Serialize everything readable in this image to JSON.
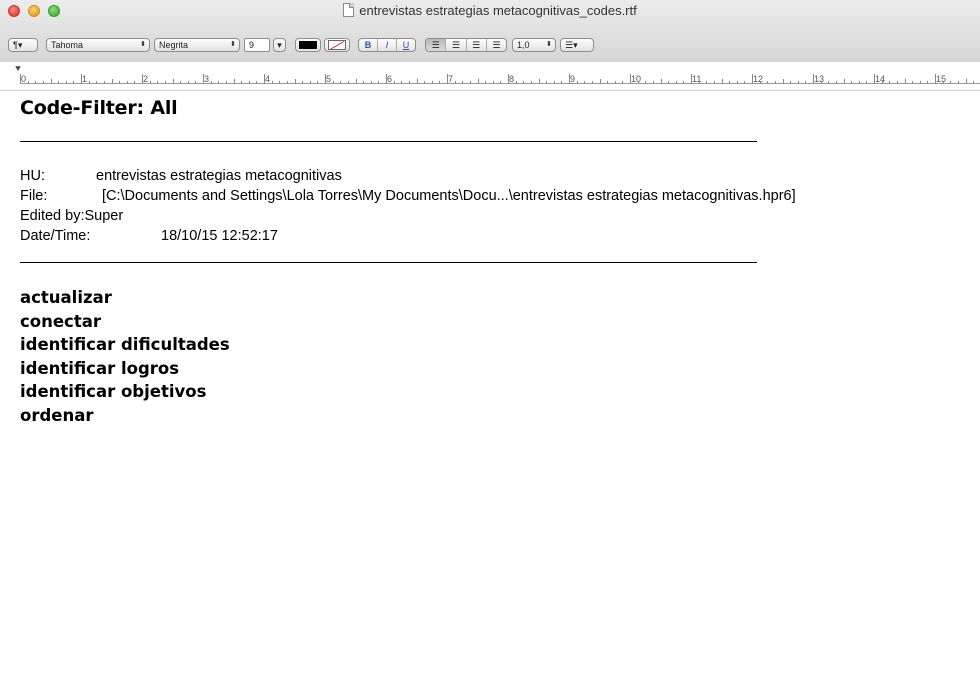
{
  "window": {
    "title": "entrevistas estrategias metacognitivas_codes.rtf"
  },
  "toolbar": {
    "paragraph_style": "¶▾",
    "font_family": "Tahoma",
    "font_typeface": "Negrita",
    "font_size": "9",
    "text_color": "#000000",
    "bold": "B",
    "italic": "I",
    "underline": "U",
    "line_spacing": "1,0",
    "list_bullets_icon": "list-bullets-icon"
  },
  "ruler": {
    "labels": [
      "0",
      "1",
      "2",
      "3",
      "4",
      "5",
      "6",
      "7",
      "8",
      "9",
      "10",
      "11",
      "12",
      "13",
      "14",
      "15"
    ]
  },
  "document": {
    "heading": "Code-Filter: All",
    "hu_label": "HU:",
    "hu_value": "entrevistas estrategias metacognitivas",
    "file_label": "File:",
    "file_value": "[C:\\Documents and Settings\\Lola Torres\\My Documents\\Docu...\\entrevistas estrategias metacognitivas.hpr6]",
    "edited_by_label": "Edited by:",
    "edited_by_value": "Super",
    "datetime_label": "Date/Time:",
    "datetime_value": "18/10/15 12:52:17",
    "codes": [
      "actualizar",
      "conectar",
      "identificar dificultades",
      "identificar logros",
      "identificar objetivos",
      "ordenar"
    ]
  }
}
